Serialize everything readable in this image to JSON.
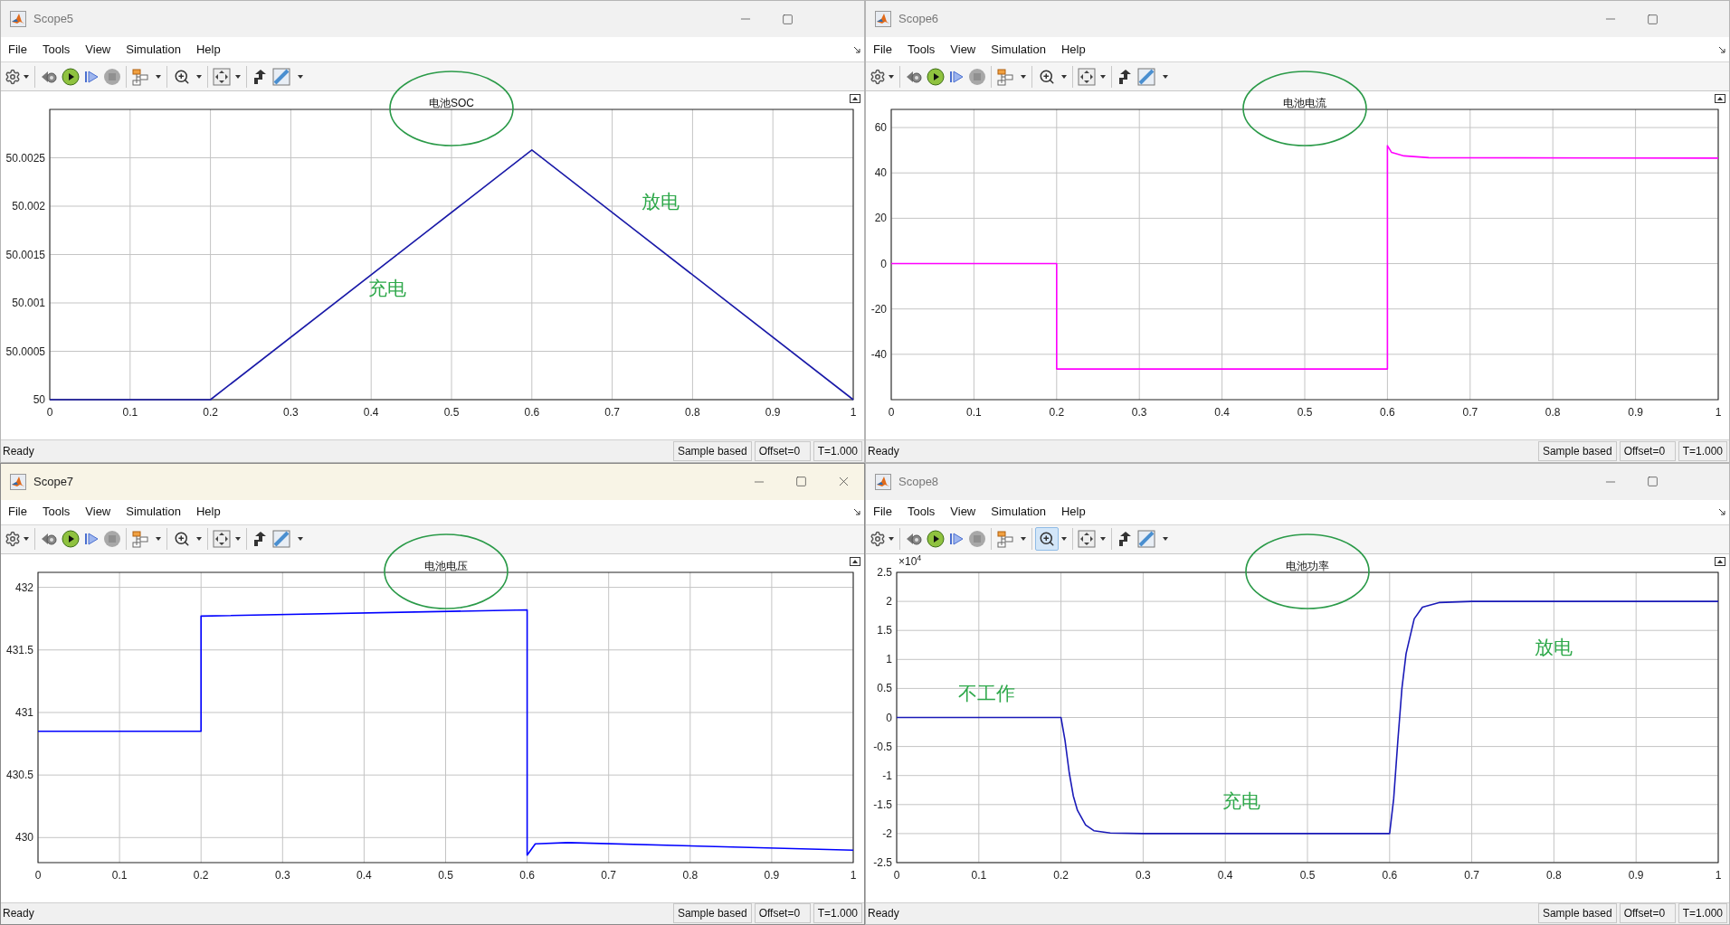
{
  "windows": [
    {
      "title": "Scope5",
      "active": false,
      "menu": [
        "File",
        "Tools",
        "View",
        "Simulation",
        "Help"
      ],
      "zoom_selected": false,
      "stop_disabled": true,
      "plot": {
        "title": "电池SOC",
        "chart_data": {
          "type": "line",
          "grid": true,
          "xlim": [
            0,
            1
          ],
          "ylim": [
            50,
            50.003
          ],
          "xticks": [
            0,
            0.1,
            0.2,
            0.3,
            0.4,
            0.5,
            0.6,
            0.7,
            0.8,
            0.9,
            1
          ],
          "yticks": [
            50,
            50.0005,
            50.001,
            50.0015,
            50.002,
            50.0025
          ],
          "x": [
            0,
            0.2,
            0.6,
            1
          ],
          "series": [
            {
              "color": "#1a1aa8",
              "values": [
                50,
                50,
                50.00258,
                50
              ]
            }
          ],
          "annotations": [
            "充电",
            "放电"
          ]
        }
      },
      "status": {
        "text": "Ready",
        "mode": "Sample based",
        "offset": "Offset=0",
        "time": "T=1.000"
      }
    },
    {
      "title": "Scope6",
      "active": false,
      "menu": [
        "File",
        "Tools",
        "View",
        "Simulation",
        "Help"
      ],
      "zoom_selected": false,
      "stop_disabled": true,
      "plot": {
        "title": "电池电流",
        "chart_data": {
          "type": "line",
          "grid": true,
          "xlim": [
            0,
            1
          ],
          "ylim": [
            -60,
            68
          ],
          "xticks": [
            0,
            0.1,
            0.2,
            0.3,
            0.4,
            0.5,
            0.6,
            0.7,
            0.8,
            0.9,
            1
          ],
          "yticks": [
            -40,
            -20,
            0,
            20,
            40,
            60
          ],
          "x": [
            0,
            0.2,
            0.2,
            0.6,
            0.6,
            0.605,
            0.62,
            0.65,
            1
          ],
          "series": [
            {
              "color": "#ff00ff",
              "values": [
                0,
                0,
                -46.5,
                -46.5,
                52,
                49,
                47.5,
                46.7,
                46.5
              ]
            }
          ]
        }
      },
      "status": {
        "text": "Ready",
        "mode": "Sample based",
        "offset": "Offset=0",
        "time": "T=1.000"
      }
    },
    {
      "title": "Scope7",
      "active": true,
      "menu": [
        "File",
        "Tools",
        "View",
        "Simulation",
        "Help"
      ],
      "zoom_selected": false,
      "stop_disabled": true,
      "plot": {
        "title": "电池电压",
        "chart_data": {
          "type": "line",
          "grid": true,
          "xlim": [
            0,
            1
          ],
          "ylim": [
            429.8,
            432.12
          ],
          "xticks": [
            0,
            0.1,
            0.2,
            0.3,
            0.4,
            0.5,
            0.6,
            0.7,
            0.8,
            0.9,
            1
          ],
          "yticks": [
            430,
            430.5,
            431,
            431.5,
            432
          ],
          "x": [
            0,
            0.2,
            0.2,
            0.6,
            0.6,
            0.61,
            0.65,
            1
          ],
          "series": [
            {
              "color": "#0000ff",
              "values": [
                430.85,
                430.85,
                431.77,
                431.82,
                429.86,
                429.95,
                429.96,
                429.9
              ]
            }
          ]
        }
      },
      "status": {
        "text": "Ready",
        "mode": "Sample based",
        "offset": "Offset=0",
        "time": "T=1.000"
      }
    },
    {
      "title": "Scope8",
      "active": false,
      "menu": [
        "File",
        "Tools",
        "View",
        "Simulation",
        "Help"
      ],
      "zoom_selected": true,
      "stop_disabled": true,
      "plot": {
        "title": "电池功率",
        "exponent": "×10$^{4}$",
        "chart_data": {
          "type": "line",
          "grid": true,
          "xlim": [
            0,
            1
          ],
          "ylim": [
            -2.5,
            2.5
          ],
          "xticks": [
            0,
            0.1,
            0.2,
            0.3,
            0.4,
            0.5,
            0.6,
            0.7,
            0.8,
            0.9,
            1
          ],
          "yticks": [
            -2.5,
            -2,
            -1.5,
            -1,
            -0.5,
            0,
            0.5,
            1,
            1.5,
            2,
            2.5
          ],
          "x": [
            0,
            0.2,
            0.205,
            0.21,
            0.215,
            0.22,
            0.23,
            0.24,
            0.26,
            0.3,
            0.6,
            0.605,
            0.61,
            0.615,
            0.62,
            0.63,
            0.64,
            0.66,
            0.7,
            1
          ],
          "series": [
            {
              "color": "#1a1ab8",
              "values": [
                0,
                0,
                -0.4,
                -0.95,
                -1.35,
                -1.6,
                -1.85,
                -1.95,
                -1.99,
                -2,
                -2,
                -1.4,
                -0.4,
                0.5,
                1.1,
                1.7,
                1.9,
                1.98,
                2,
                2
              ]
            }
          ],
          "annotations": [
            "不工作",
            "充电",
            "放电"
          ]
        }
      },
      "status": {
        "text": "Ready",
        "mode": "Sample based",
        "offset": "Offset=0",
        "time": "T=1.000"
      }
    }
  ]
}
